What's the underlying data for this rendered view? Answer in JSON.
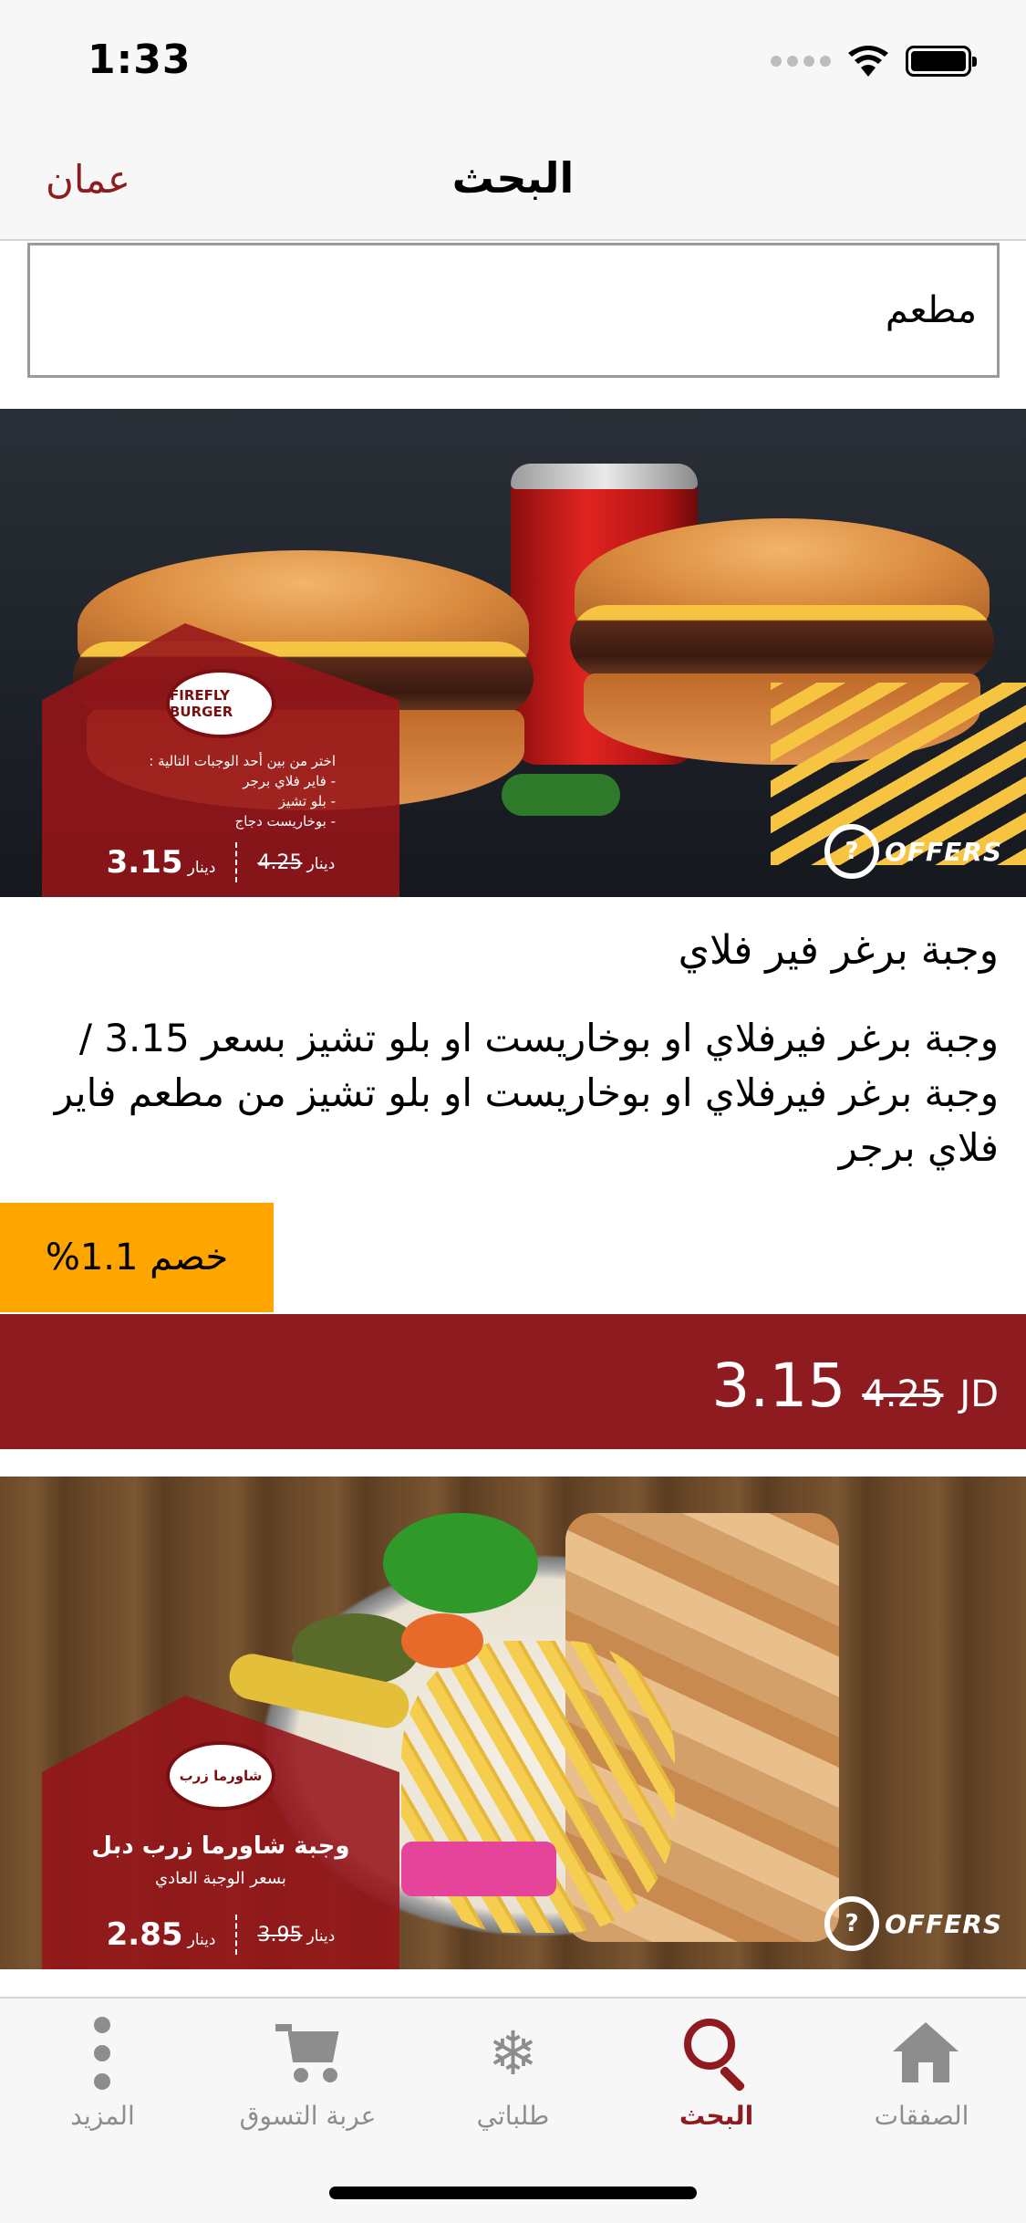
{
  "status_bar": {
    "time": "1:33"
  },
  "nav": {
    "title": "البحث",
    "city": "عمان"
  },
  "search": {
    "value": "مطعم"
  },
  "offer1": {
    "badge": {
      "logo_text": "FIREFLY BURGER",
      "lines": [
        "اختر من بين أحد الوجبات التالية :",
        "- فاير فلاي برجر",
        "- بلو تشيز",
        "- بوخاريست دجاج"
      ],
      "new_price": "3.15",
      "old_price": "4.25",
      "currency": "دينار"
    },
    "brand": "OFFERS",
    "title": "وجبة برغر فير فلاي",
    "description": "وجبة برغر فيرفلاي او بوخاريست او بلو تشيز بسعر 3.15 / وجبة برغر فيرفلاي او بوخاريست او بلو تشيز من مطعم فاير فلاي برجر",
    "discount": "خصم 1.1%",
    "price_new": "3.15",
    "price_old": "4.25",
    "currency": "JD"
  },
  "offer2": {
    "badge": {
      "logo_text": "شاورما زرب",
      "title": "وجبة شاورما زرب دبل",
      "subtitle": "بسعر الوجبة العادي",
      "new_price": "2.85",
      "old_price": "3.95",
      "currency": "دينار"
    },
    "brand": "OFFERS"
  },
  "tabs": [
    {
      "label": "الصفقات",
      "icon": "home-icon",
      "active": false
    },
    {
      "label": "البحث",
      "icon": "search-icon",
      "active": true
    },
    {
      "label": "طلباتي",
      "icon": "snowflake-icon",
      "active": false
    },
    {
      "label": "عربة التسوق",
      "icon": "cart-icon",
      "active": false
    },
    {
      "label": "المزيد",
      "icon": "more-icon",
      "active": false
    }
  ],
  "colors": {
    "brand": "#8e1b20",
    "discount": "#ffa500",
    "bar_bg": "#f7f7f7",
    "inactive": "#8d8d8d"
  }
}
